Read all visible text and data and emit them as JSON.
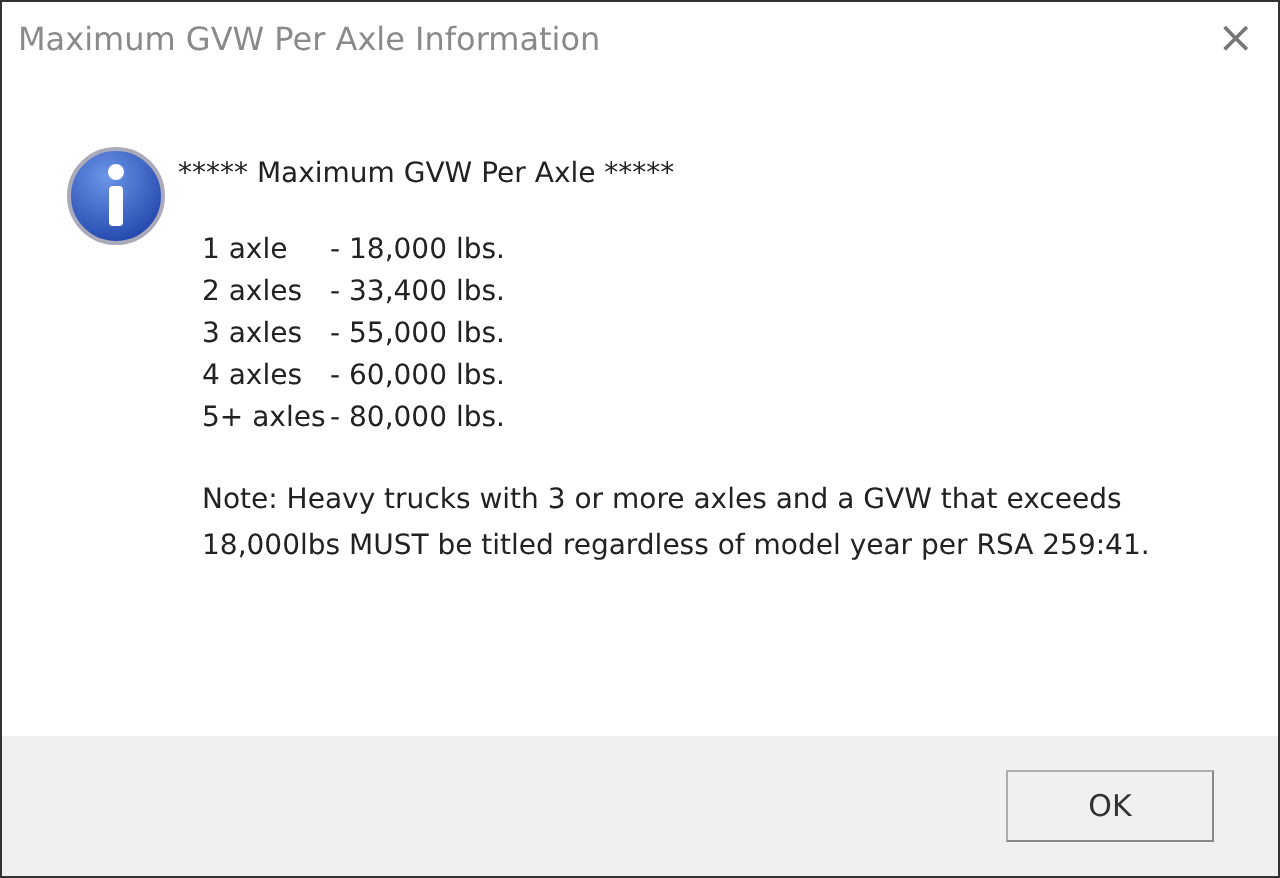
{
  "window": {
    "title": "Maximum GVW Per Axle Information",
    "close": "×"
  },
  "message": {
    "heading": "*****  Maximum GVW Per Axle *****",
    "rows": [
      {
        "axles": "1 axle",
        "weight": "- 18,000 lbs."
      },
      {
        "axles": "2 axles",
        "weight": "- 33,400 lbs."
      },
      {
        "axles": "3 axles",
        "weight": "- 55,000 lbs."
      },
      {
        "axles": "4 axles",
        "weight": "- 60,000 lbs."
      },
      {
        "axles": "5+ axles",
        "weight": "- 80,000 lbs."
      }
    ],
    "note": "Note: Heavy trucks with 3 or more axles and a GVW that exceeds 18,000lbs MUST be titled regardless of model year per RSA 259:41."
  },
  "buttons": [
    "OK"
  ]
}
